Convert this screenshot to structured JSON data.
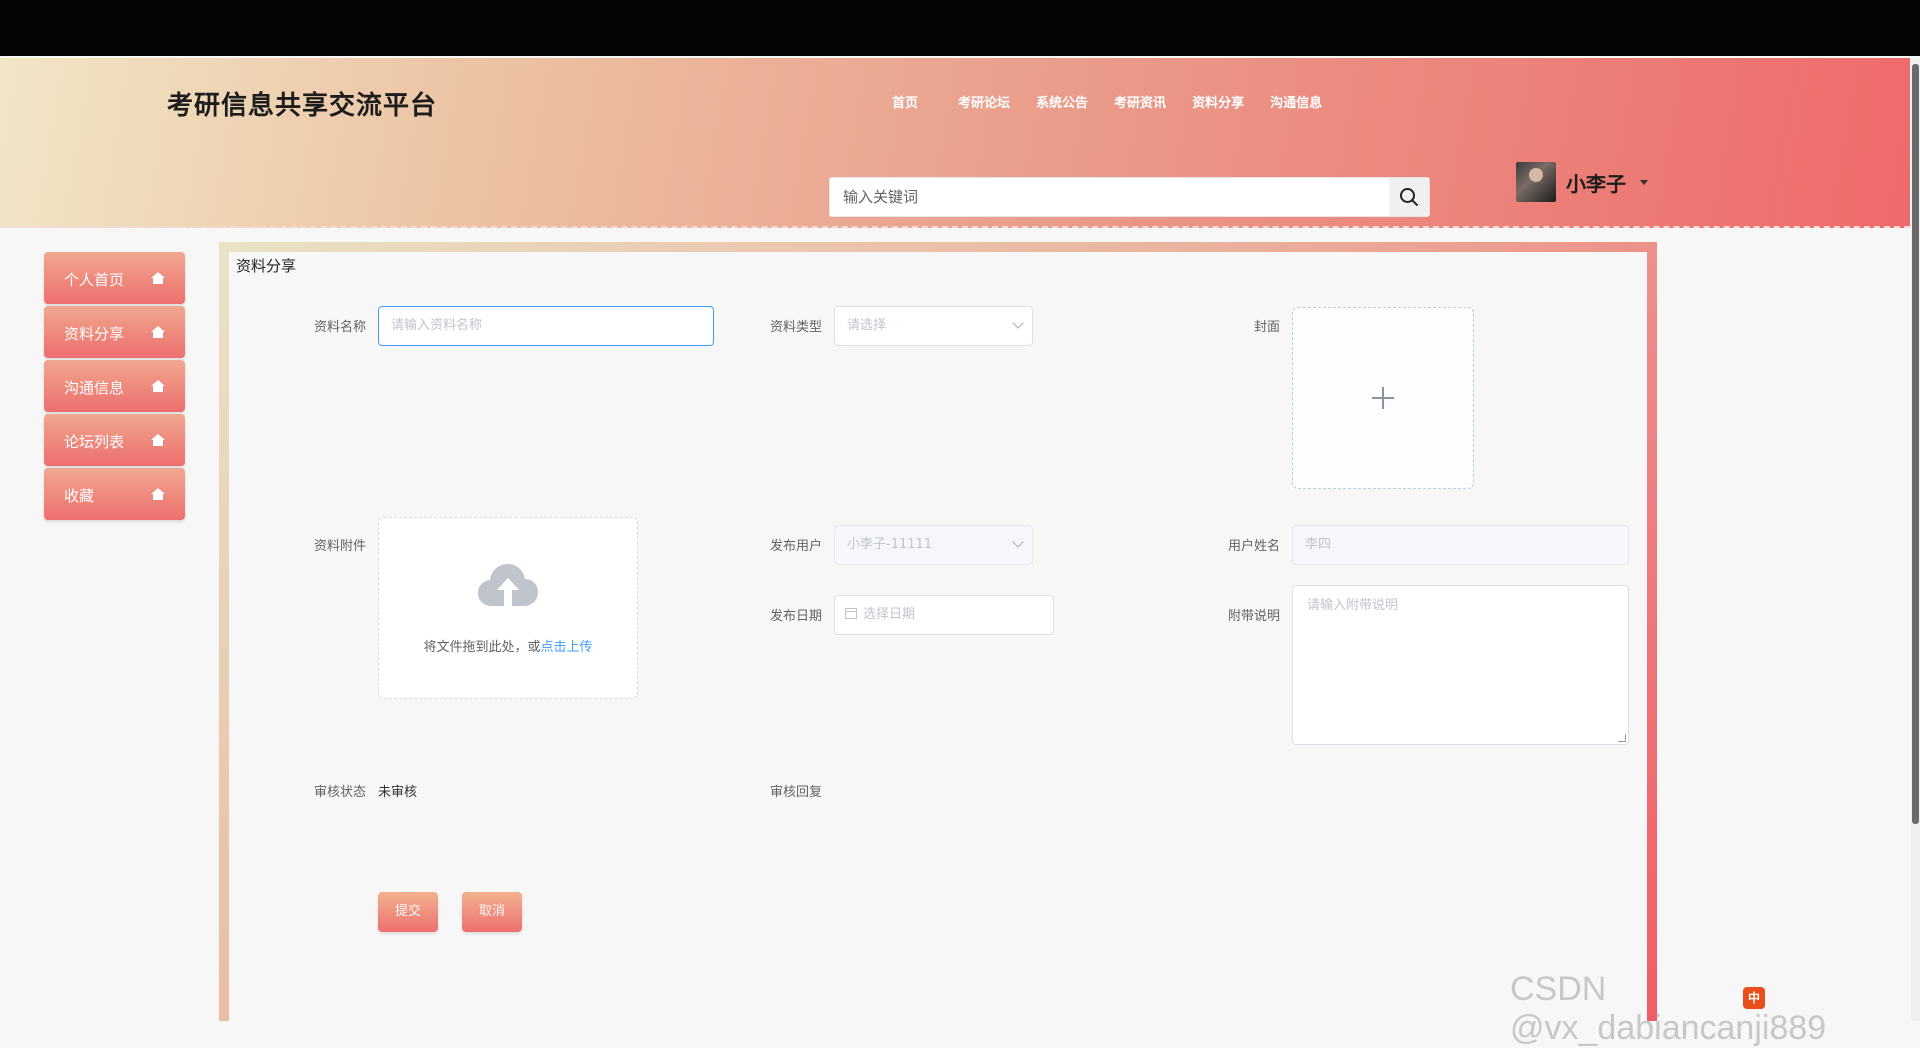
{
  "header": {
    "site_title": "考研信息共享交流平台",
    "nav": [
      "首页",
      "考研论坛",
      "系统公告",
      "考研资讯",
      "资料分享",
      "沟通信息"
    ],
    "search_placeholder": "输入关键词",
    "username": "小李子"
  },
  "sidebar": {
    "items": [
      {
        "label": "个人首页"
      },
      {
        "label": "资料分享"
      },
      {
        "label": "沟通信息"
      },
      {
        "label": "论坛列表"
      },
      {
        "label": "收藏"
      }
    ]
  },
  "form": {
    "title": "资料分享",
    "name_label": "资料名称",
    "name_placeholder": "请输入资料名称",
    "type_label": "资料类型",
    "type_placeholder": "请选择",
    "cover_label": "封面",
    "attachment_label": "资料附件",
    "upload_tip": "将文件拖到此处，或",
    "upload_link": "点击上传",
    "publisher_label": "发布用户",
    "publisher_value": "小李子-11111",
    "realname_label": "用户姓名",
    "realname_value": "李四",
    "date_label": "发布日期",
    "date_placeholder": "选择日期",
    "note_label": "附带说明",
    "note_placeholder": "请输入附带说明",
    "audit_status_label": "审核状态",
    "audit_status_value": "未审核",
    "audit_reply_label": "审核回复",
    "submit_label": "提交",
    "cancel_label": "取消"
  },
  "watermark": "CSDN @vx_dabiancanji889",
  "tray": {
    "ime": "中"
  },
  "colors": {
    "accent": "#ee6e6e",
    "link": "#409eff",
    "focus_border": "#409eff"
  }
}
